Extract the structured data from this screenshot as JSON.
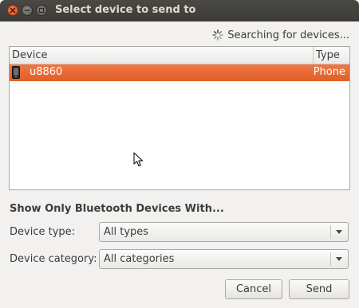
{
  "window": {
    "title": "Select device to send to"
  },
  "status": {
    "searching_text": "Searching for devices...",
    "icon": "spinner-icon"
  },
  "device_list": {
    "columns": [
      "Device",
      "Type"
    ],
    "rows": [
      {
        "name": "u8860",
        "type": "Phone",
        "icon": "phone-icon",
        "selected": true
      }
    ]
  },
  "filter": {
    "heading": "Show Only Bluetooth Devices With...",
    "device_type_label": "Device type:",
    "device_type_value": "All types",
    "device_category_label": "Device category:",
    "device_category_value": "All categories"
  },
  "buttons": {
    "cancel": "Cancel",
    "send": "Send"
  },
  "colors": {
    "titlebar": "#3c3b37",
    "selection": "#e86a36",
    "window_bg": "#f2f1f0"
  }
}
